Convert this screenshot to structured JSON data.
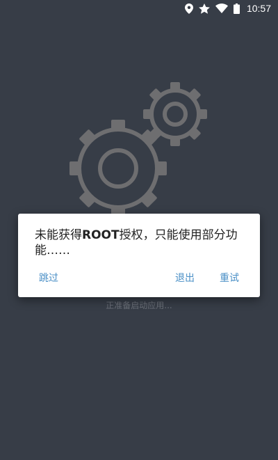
{
  "status_bar": {
    "time": "10:57",
    "icons": [
      "location-icon",
      "star-icon",
      "wifi-icon",
      "battery-icon"
    ]
  },
  "splash": {
    "icon": "gears-icon",
    "status_text": "正准备启动应用..."
  },
  "dialog": {
    "message_before": "未能获得",
    "message_bold": "ROOT",
    "message_after": "授权，只能使用部分功能……",
    "skip_label": "跳过",
    "exit_label": "退出",
    "retry_label": "重试"
  },
  "colors": {
    "background": "#373d47",
    "dialog_button": "#4a8fc6",
    "gear": "#6e6e70"
  }
}
